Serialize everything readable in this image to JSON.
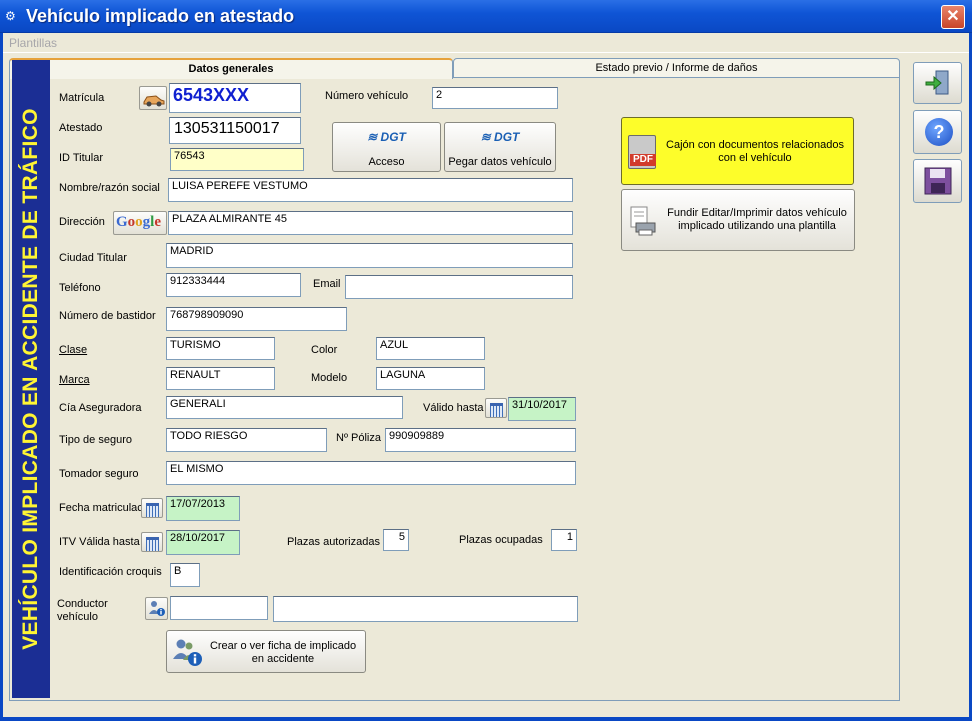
{
  "window": {
    "title": "Vehículo implicado en atestado",
    "close_glyph": "✕"
  },
  "menu": {
    "plantillas": "Plantillas"
  },
  "tabs": {
    "general": "Datos generales",
    "estado": "Estado previo / Informe de daños"
  },
  "banner": "VEHÍCULO IMPLICADO EN ACCIDENTE DE TRÁFICO",
  "labels": {
    "matricula": "Matrícula",
    "numero_vehiculo": "Número vehículo",
    "atestado": "Atestado",
    "id_titular": "ID Titular",
    "nombre": "Nombre/razón social",
    "direccion": "Dirección",
    "ciudad": "Ciudad Titular",
    "telefono": "Teléfono",
    "email": "Email",
    "bastidor": "Número de bastidor",
    "clase": "Clase",
    "color": "Color",
    "marca": "Marca",
    "modelo": "Modelo",
    "aseguradora": "Cía Aseguradora",
    "valido_hasta": "Válido hasta",
    "tipo_seguro": "Tipo de seguro",
    "poliza": "Nº Póliza",
    "tomador": "Tomador seguro",
    "fecha_matric": "Fecha matriculac",
    "itv": "ITV Válida hasta",
    "plazas_aut": "Plazas autorizadas",
    "plazas_ocup": "Plazas ocupadas",
    "croquis": "Identificación croquis",
    "conductor_1": "Conductor",
    "conductor_2": "vehículo"
  },
  "values": {
    "matricula": "6543XXX",
    "numero_vehiculo": "2",
    "atestado": "130531150017",
    "id_titular": "76543",
    "nombre": "LUISA PEREFE VESTUMO",
    "direccion": "PLAZA ALMIRANTE 45",
    "ciudad": "MADRID",
    "telefono": "912333444",
    "email": "",
    "bastidor": "768798909090",
    "clase": "TURISMO",
    "color": "AZUL",
    "marca": "RENAULT",
    "modelo": "LAGUNA",
    "aseguradora": "GENERALI",
    "valido_hasta": "31/10/2017",
    "tipo_seguro": "TODO RIESGO",
    "poliza": "990909889",
    "tomador": "EL MISMO",
    "fecha_matric": "17/07/2013",
    "itv": "28/10/2017",
    "plazas_aut": "5",
    "plazas_ocup": "1",
    "croquis": "B",
    "conductor_id": "",
    "conductor_nombre": ""
  },
  "buttons": {
    "dgt_logo": "DGT",
    "dgt_acceso": "Acceso",
    "dgt_pegar": "Pegar datos vehículo",
    "google": "Google",
    "cajon": "Cajón con documentos relacionados con el vehículo",
    "fundir": "Fundir Editar/Imprimir datos vehículo implicado utilizando una plantilla",
    "crear_ficha": "Crear o ver ficha de implicado en accidente",
    "pdf_badge": "PDF",
    "help_glyph": "?"
  }
}
